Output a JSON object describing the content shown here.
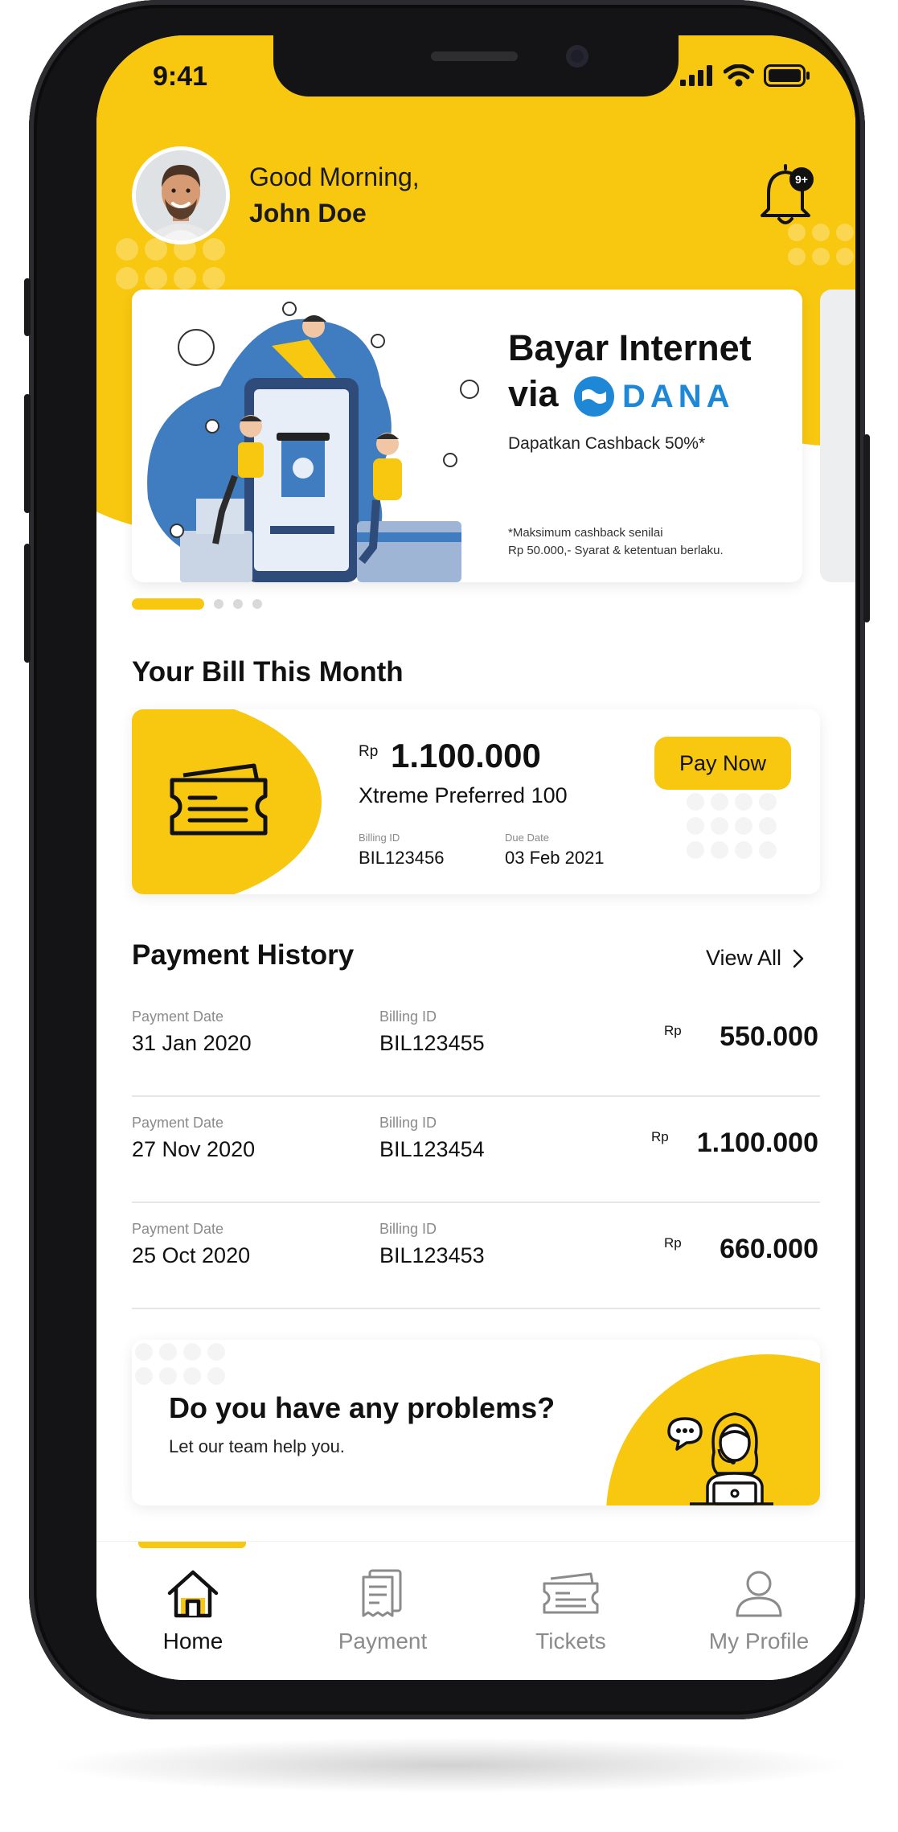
{
  "status_bar": {
    "time": "9:41"
  },
  "greeting": {
    "line": "Good Morning,",
    "name": "John Doe",
    "notification_badge": "9+"
  },
  "promo_banner": {
    "title": "Bayar Internet",
    "via": "via",
    "brand": "DANA",
    "subtitle": "Dapatkan Cashback 50%*",
    "note_line1": "*Maksimum cashback senilai",
    "note_line2": "Rp 50.000,- Syarat & ketentuan berlaku.",
    "page_count": 4,
    "active_page": 1
  },
  "bill": {
    "section_title": "Your Bill This Month",
    "currency": "Rp",
    "amount": "1.100.000",
    "plan": "Xtreme Preferred 100",
    "billing_id_label": "Billing ID",
    "billing_id": "BIL123456",
    "due_date_label": "Due Date",
    "due_date": "03 Feb 2021",
    "pay_button": "Pay Now"
  },
  "history": {
    "section_title": "Payment History",
    "view_all": "View All",
    "items": [
      {
        "date_label": "Payment Date",
        "date": "31 Jan 2020",
        "id_label": "Billing ID",
        "billing_id": "BIL123455",
        "currency": "Rp",
        "amount": "550.000"
      },
      {
        "date_label": "Payment Date",
        "date": "27 Nov 2020",
        "id_label": "Billing ID",
        "billing_id": "BIL123454",
        "currency": "Rp",
        "amount": "1.100.000"
      },
      {
        "date_label": "Payment Date",
        "date": "25 Oct 2020",
        "id_label": "Billing ID",
        "billing_id": "BIL123453",
        "currency": "Rp",
        "amount": "660.000"
      }
    ]
  },
  "help": {
    "title": "Do you have any problems?",
    "subtitle": "Let our team help you."
  },
  "tabs": [
    {
      "label": "Home",
      "icon": "home-icon",
      "active": true
    },
    {
      "label": "Payment",
      "icon": "receipt-icon",
      "active": false
    },
    {
      "label": "Tickets",
      "icon": "ticket-icon",
      "active": false
    },
    {
      "label": "My Profile",
      "icon": "profile-icon",
      "active": false
    }
  ],
  "colors": {
    "accent": "#f8c70f",
    "dana_blue": "#1f88d6",
    "text": "#111111",
    "muted": "#8b8b8b"
  }
}
